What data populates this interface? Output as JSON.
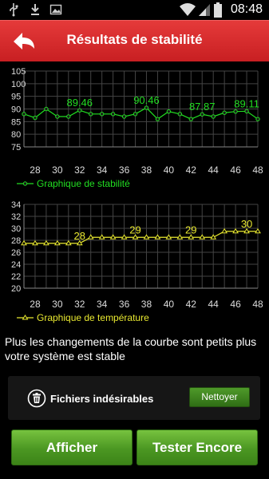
{
  "status_bar": {
    "time": "08:48",
    "icons": [
      "usb-icon",
      "download-icon",
      "image-icon",
      "wifi-icon",
      "signal-icon",
      "battery-icon"
    ]
  },
  "header": {
    "title": "Résultats de stabilité",
    "back_icon": "back-arrow-icon"
  },
  "stability_chart": {
    "chart_data": {
      "type": "line",
      "x": [
        27,
        28,
        29,
        30,
        31,
        32,
        33,
        34,
        35,
        36,
        37,
        38,
        39,
        40,
        41,
        42,
        43,
        44,
        45,
        46,
        47,
        48
      ],
      "series": [
        {
          "name": "Graphique de stabilité",
          "values": [
            88,
            86.5,
            90,
            87,
            87,
            89.46,
            88,
            88,
            88,
            87,
            88,
            90.46,
            86,
            89,
            88,
            86,
            87.87,
            87,
            88.5,
            89,
            89.11,
            86
          ]
        }
      ],
      "yticks": [
        "105",
        "100",
        "95",
        "90",
        "85",
        "80",
        "75"
      ],
      "xticks": [
        "28",
        "30",
        "32",
        "34",
        "36",
        "38",
        "40",
        "42",
        "44",
        "46",
        "48"
      ],
      "ylim": [
        75,
        105
      ],
      "data_labels": [
        "89.46",
        "90.46",
        "87.87",
        "89.11"
      ],
      "grid": true,
      "legend": "bottom-left",
      "color": "#22dd22"
    }
  },
  "temperature_chart": {
    "chart_data": {
      "type": "line",
      "x": [
        27,
        28,
        29,
        30,
        31,
        32,
        33,
        34,
        35,
        36,
        37,
        38,
        39,
        40,
        41,
        42,
        43,
        44,
        45,
        46,
        47,
        48
      ],
      "series": [
        {
          "name": "Graphique de température",
          "values": [
            27.5,
            27.5,
            27.5,
            27.5,
            27.5,
            27.5,
            28.5,
            28.5,
            28.5,
            28.5,
            28.5,
            28.5,
            28.5,
            28.5,
            28.5,
            28.5,
            28.5,
            28.5,
            29.5,
            29.5,
            29.5,
            29.5
          ]
        }
      ],
      "yticks": [
        "34",
        "32",
        "30",
        "28",
        "26",
        "24",
        "22",
        "20"
      ],
      "xticks": [
        "28",
        "30",
        "32",
        "34",
        "36",
        "38",
        "40",
        "42",
        "44",
        "46",
        "48"
      ],
      "ylim": [
        20,
        34
      ],
      "data_labels": [
        "28",
        "29",
        "29",
        "30"
      ],
      "grid": true,
      "legend": "bottom-left",
      "color": "#e8e830"
    }
  },
  "description": "Plus les changements de la courbe sont petits plus votre système est stable",
  "junk": {
    "label": "Fichiers indésirables",
    "button": "Nettoyer"
  },
  "buttons": {
    "show": "Afficher",
    "retest": "Tester Encore"
  }
}
